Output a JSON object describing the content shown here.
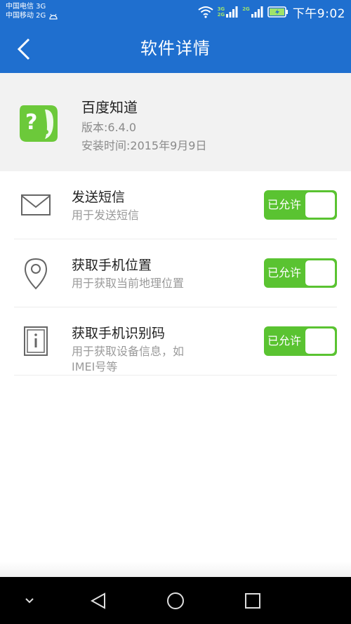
{
  "status_bar": {
    "carrier1": "中国电信 3G",
    "carrier2": "中国移动 2G",
    "net_label_top": "3G",
    "net_label_bottom": "2G",
    "net_label_right": "2G",
    "time": "下午9:02"
  },
  "header": {
    "title": "软件详情"
  },
  "app": {
    "name": "百度知道",
    "version": "版本:6.4.0",
    "install_time": "安装时间:2015年9月9日"
  },
  "permissions": [
    {
      "title": "发送短信",
      "desc": "用于发送短信",
      "status": "已允许",
      "icon": "envelope-icon"
    },
    {
      "title": "获取手机位置",
      "desc": "用于获取当前地理位置",
      "status": "已允许",
      "icon": "location-pin-icon"
    },
    {
      "title": "获取手机识别码",
      "desc": "用于获取设备信息，如IMEI号等",
      "status": "已允许",
      "icon": "device-info-icon"
    }
  ],
  "colors": {
    "header_blue": "#1f6fcf",
    "toggle_green": "#5ac331",
    "app_icon_green": "#6cc93a"
  },
  "nav_bar": {
    "icons": [
      "chevron-down-icon",
      "back-triangle-icon",
      "home-circle-icon",
      "recents-square-icon"
    ]
  }
}
